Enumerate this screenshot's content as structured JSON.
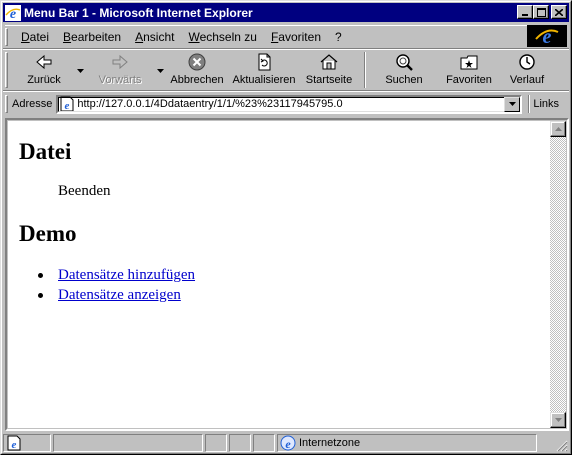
{
  "window": {
    "title": "Menu Bar 1 - Microsoft Internet Explorer"
  },
  "menubar": {
    "items": [
      "Datei",
      "Bearbeiten",
      "Ansicht",
      "Wechseln zu",
      "Favoriten",
      "?"
    ]
  },
  "toolbar": {
    "buttons": [
      {
        "label": "Zurück",
        "icon": "back-arrow-icon",
        "enabled": true
      },
      {
        "label": "Vorwärts",
        "icon": "forward-arrow-icon",
        "enabled": false
      },
      {
        "label": "Abbrechen",
        "icon": "stop-icon",
        "enabled": true
      },
      {
        "label": "Aktualisieren",
        "icon": "refresh-icon",
        "enabled": true
      },
      {
        "label": "Startseite",
        "icon": "home-icon",
        "enabled": true
      },
      {
        "label": "Suchen",
        "icon": "search-icon",
        "enabled": true
      },
      {
        "label": "Favoriten",
        "icon": "favorites-icon",
        "enabled": true
      },
      {
        "label": "Verlauf",
        "icon": "history-icon",
        "enabled": true
      }
    ]
  },
  "addressbar": {
    "label": "Adresse",
    "url": "http://127.0.0.1/4Ddataentry/1/1/%23%23117945795.0",
    "links_label": "Links"
  },
  "content": {
    "heading1": "Datei",
    "menu_entry": "Beenden",
    "heading2": "Demo",
    "links": [
      "Datensätze hinzufügen",
      "Datensätze anzeigen"
    ]
  },
  "statusbar": {
    "zone": "Internetzone"
  },
  "colors": {
    "titlebar": "#000080",
    "chrome": "#c0c0c0",
    "link": "#0000cc"
  }
}
